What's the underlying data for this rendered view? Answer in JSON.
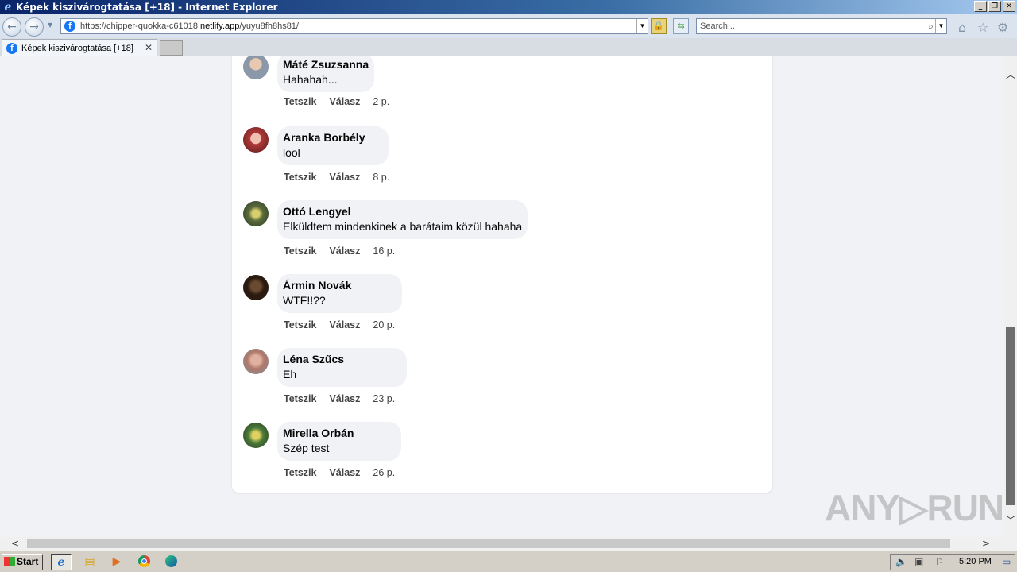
{
  "window": {
    "title": "Képek kiszivárogtatása [+18] - Internet Explorer",
    "controls": [
      "_",
      "❐",
      "✕"
    ]
  },
  "address_bar": {
    "url_prefix": "https://chipper-quokka-c61018.",
    "url_domain": "netlify.app",
    "url_path": "/yuyu8fh8hs81/",
    "search_placeholder": "Search..."
  },
  "tabs": [
    {
      "label": "Képek kiszivárogtatása [+18]",
      "active": true
    }
  ],
  "comments": [
    {
      "name": "Máté Zsuzsanna",
      "text": "Hahahah...",
      "like": "Tetszik",
      "reply": "Válasz",
      "time": "2 p.",
      "avatar_color": "#8a98a8"
    },
    {
      "name": "Aranka Borbély",
      "text": "lool",
      "like": "Tetszik",
      "reply": "Válasz",
      "time": "8 p.",
      "avatar_color": "#b03a3a"
    },
    {
      "name": "Ottó Lengyel",
      "text": "Elküldtem mindenkinek a barátaim közül hahaha",
      "like": "Tetszik",
      "reply": "Válasz",
      "time": "16 p.",
      "avatar_color": "#5b6b3a"
    },
    {
      "name": "Ármin Novák",
      "text": "WTF!!??",
      "like": "Tetszik",
      "reply": "Válasz",
      "time": "20 p.",
      "avatar_color": "#2a1a10"
    },
    {
      "name": "Léna Szűcs",
      "text": "Eh",
      "like": "Tetszik",
      "reply": "Válasz",
      "time": "23 p.",
      "avatar_color": "#b07a6a"
    },
    {
      "name": "Mirella Orbán",
      "text": "Szép test",
      "like": "Tetszik",
      "reply": "Válasz",
      "time": "26 p.",
      "avatar_color": "#4a7a3a"
    }
  ],
  "watermark": "ANY▷RUN",
  "taskbar": {
    "start_label": "Start",
    "clock": "5:20 PM"
  }
}
